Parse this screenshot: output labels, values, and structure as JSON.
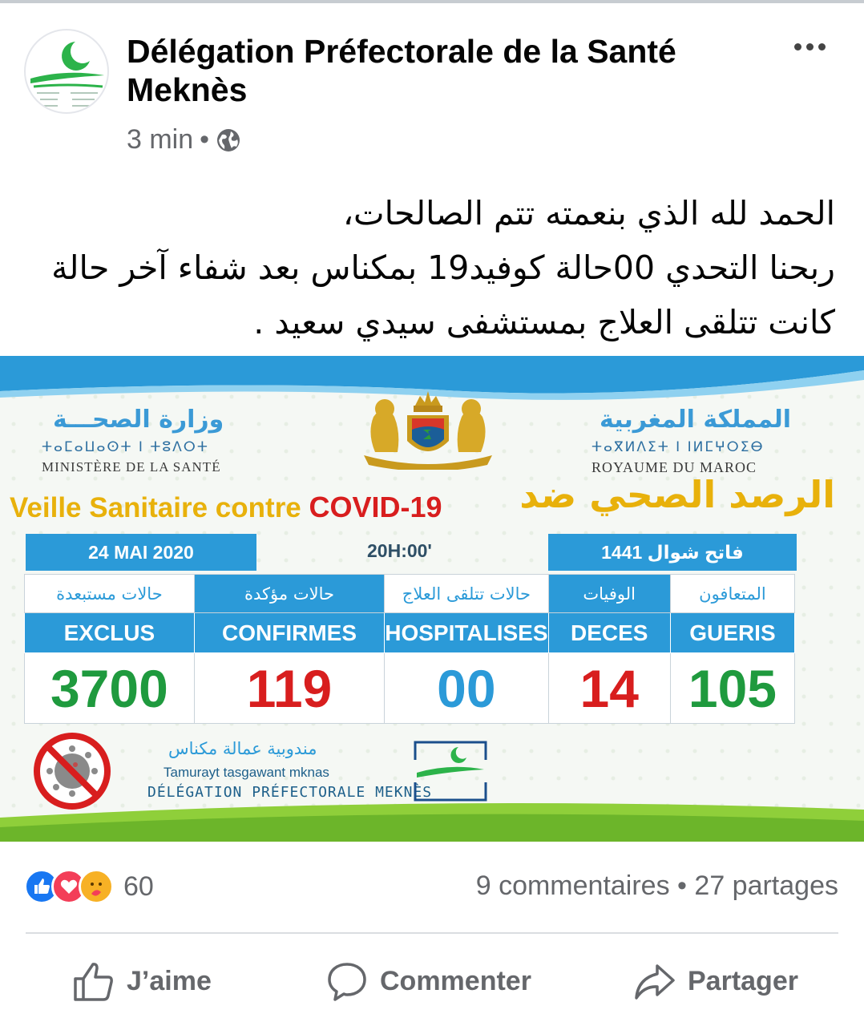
{
  "post": {
    "page_name": "Délégation Préfectorale de la Santé Meknès",
    "time": "3 min",
    "separator": "•",
    "text_lines": [
      "الحمد لله  الذي بنعمته تتم الصالحات،",
      "ربحنا التحدي 00حالة كوفيد19 بمكناس بعد شفاء آخر حالة",
      "كانت تتلقى العلاج بمستشفى سيدي سعيد ."
    ]
  },
  "infographic": {
    "ministry_ar": "وزارة الصحـــة",
    "ministry_tifinagh": "ⵜⴰⵎⴰⵡⴰⵙⵜ  I  ⵜⵓⴷⵔⵜ",
    "ministry_fr": "MINISTÈRE  DE LA SANTÉ",
    "kingdom_ar": "المملكة المغربية",
    "kingdom_tifinagh": "ⵜⴰⴳⵍⴷⵉⵜ  I  ⵏⵍⵎⵖⵔⵉⴱ",
    "kingdom_fr": "ROYAUME  DU MAROC",
    "title_fr_part1": "Veille  Sanitaire contre",
    "title_fr_part2": "COVID-19",
    "title_ar": "الرصد الصحي ضد",
    "date": "24  MAI  2020",
    "time": "20H:00'",
    "hijri_date": "فاتح شوال 1441",
    "columns_ar": [
      "حالات مستبعدة",
      "حالات مؤكدة",
      "حالات تتلقى العلاج",
      "الوفيات",
      "المتعافون"
    ],
    "columns_fr": [
      "EXCLUS",
      "CONFIRMES",
      "HOSPITALISES",
      "DECES",
      "GUERIS"
    ],
    "values": [
      "3700",
      "119",
      "00",
      "14",
      "105"
    ],
    "delegation_ar": "مندوبية  عمالة  مكناس",
    "delegation_tz": "Tamurayt tasgawant mknas",
    "delegation_fr": "DÉLÉGATION  PRÉFECTORALE  MEKNÈS"
  },
  "reactions": {
    "count": "60",
    "comments": "9 commentaires",
    "dot": "•",
    "shares": "27 partages"
  },
  "actions": {
    "like": "J’aime",
    "comment": "Commenter",
    "share": "Partager"
  },
  "colors": {
    "accent_blue": "#2b9ad8",
    "green": "#1f9a3e",
    "red": "#d81e1e",
    "yellow": "#e8b10b"
  }
}
